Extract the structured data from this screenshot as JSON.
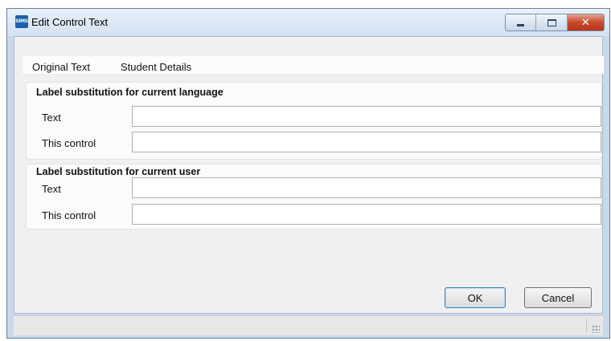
{
  "window": {
    "app_icon_text": "SIMS",
    "title": "Edit Control Text"
  },
  "original": {
    "label": "Original Text",
    "value": "Student Details"
  },
  "language_group": {
    "title": "Label substitution for current language",
    "text_label": "Text",
    "text_value": "",
    "control_label": "This control",
    "control_value": ""
  },
  "user_group": {
    "title": "Label substitution for current user",
    "text_label": "Text",
    "text_value": "",
    "control_label": "This control",
    "control_value": ""
  },
  "buttons": {
    "ok": "OK",
    "cancel": "Cancel"
  }
}
